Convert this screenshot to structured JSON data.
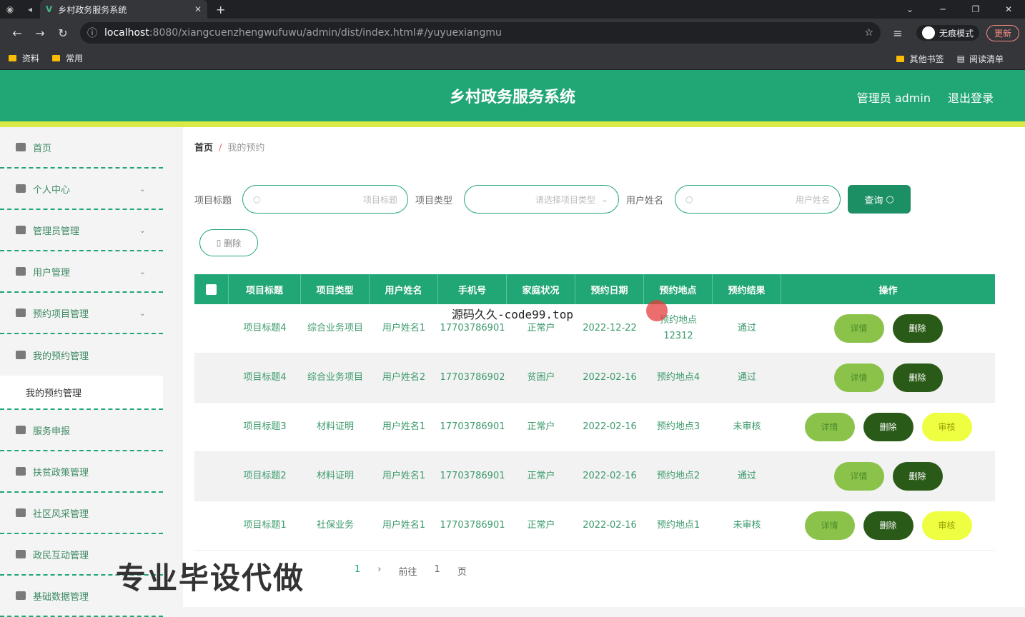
{
  "browser": {
    "tab_title": "乡村政务服务系统",
    "url_host": "localhost",
    "url_path": ":8080/xiangcuenzhengwufuwu/admin/dist/index.html#/yuyuexiangmu",
    "incognito_label": "无痕模式",
    "update_label": "更新",
    "bookmarks": [
      "资料",
      "常用"
    ],
    "bookmarks_right": [
      "其他书签",
      "阅读清单"
    ]
  },
  "header": {
    "title": "乡村政务服务系统",
    "admin_label": "管理员 admin",
    "logout_label": "退出登录"
  },
  "sidebar": {
    "items": [
      {
        "label": "首页",
        "chev": ""
      },
      {
        "label": "个人中心",
        "chev": "⌄"
      },
      {
        "label": "管理员管理",
        "chev": "⌄"
      },
      {
        "label": "用户管理",
        "chev": "⌄"
      },
      {
        "label": "预约项目管理",
        "chev": "⌄"
      },
      {
        "label": "我的预约管理",
        "chev": ""
      }
    ],
    "sub_item": "我的预约管理",
    "items_after": [
      {
        "label": "服务申报"
      },
      {
        "label": "扶贫政策管理"
      },
      {
        "label": "社区风采管理"
      },
      {
        "label": "政民互动管理"
      },
      {
        "label": "基础数据管理"
      }
    ]
  },
  "breadcrumb": {
    "home": "首页",
    "separator": "/",
    "current": "我的预约"
  },
  "filters": {
    "title_label": "项目标题",
    "title_placeholder": "项目标题",
    "type_label": "项目类型",
    "type_placeholder": "请选择项目类型",
    "name_label": "用户姓名",
    "name_placeholder": "用户姓名",
    "query_button": "查询"
  },
  "batch_delete": "删除",
  "table": {
    "headers": [
      "项目标题",
      "项目类型",
      "用户姓名",
      "手机号",
      "家庭状况",
      "预约日期",
      "预约地点",
      "预约结果",
      "操作"
    ],
    "rows": [
      {
        "title": "项目标题4",
        "type": "综合业务项目",
        "user": "用户姓名1",
        "phone": "17703786901",
        "family": "正常户",
        "date": "2022-12-22",
        "place": "预约地点12312",
        "result": "通过",
        "audit": false
      },
      {
        "title": "项目标题4",
        "type": "综合业务项目",
        "user": "用户姓名2",
        "phone": "17703786902",
        "family": "贫困户",
        "date": "2022-02-16",
        "place": "预约地点4",
        "result": "通过",
        "audit": false
      },
      {
        "title": "项目标题3",
        "type": "材料证明",
        "user": "用户姓名1",
        "phone": "17703786901",
        "family": "正常户",
        "date": "2022-02-16",
        "place": "预约地点3",
        "result": "未审核",
        "audit": true
      },
      {
        "title": "项目标题2",
        "type": "材料证明",
        "user": "用户姓名1",
        "phone": "17703786901",
        "family": "正常户",
        "date": "2022-02-16",
        "place": "预约地点2",
        "result": "通过",
        "audit": false
      },
      {
        "title": "项目标题1",
        "type": "社保业务",
        "user": "用户姓名1",
        "phone": "17703786901",
        "family": "正常户",
        "date": "2022-02-16",
        "place": "预约地点1",
        "result": "未审核",
        "audit": true
      }
    ],
    "op_detail": "详情",
    "op_delete": "删除",
    "op_audit": "审核"
  },
  "pager": {
    "page": "1",
    "goto_label": "前往",
    "goto_value": "1",
    "page_suffix": "页"
  },
  "overlays": {
    "watermark_line": "源码久久-code99.top",
    "big_text": "专业毕设代做"
  }
}
